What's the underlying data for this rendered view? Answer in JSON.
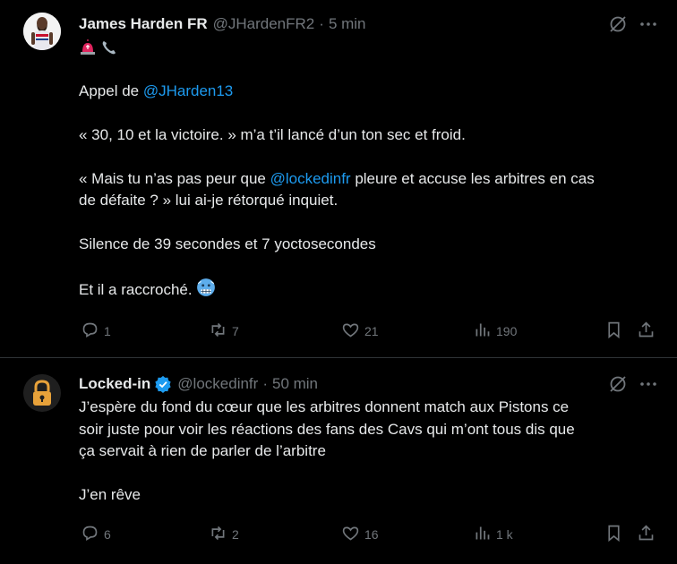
{
  "tweets": [
    {
      "name": "James Harden FR",
      "handle": "@JHardenFR2",
      "separator": "·",
      "time": "5 min",
      "lines": {
        "l1_prefix": "Appel de ",
        "l1_mention": "@JHarden13",
        "l2": "« 30, 10 et la victoire. » m’a t’il lancé d’un ton sec et froid.",
        "l3_prefix": "« Mais tu n’as pas peur que ",
        "l3_mention": "@lockedinfr",
        "l3_suffix": " pleure et accuse les arbitres en cas",
        "l3_cont": "de défaite ? » lui ai-je rétorqué inquiet.",
        "l4": "Silence de 39 secondes et 7 yoctosecondes",
        "l5": "Et il a raccroché. "
      },
      "emojis": [
        "siren-emoji",
        "telephone-emoji",
        "cold-face-emoji"
      ],
      "stats": {
        "replies": "1",
        "reposts": "7",
        "likes": "21",
        "views": "190"
      }
    },
    {
      "name": "Locked-in",
      "handle": "@lockedinfr",
      "separator": "·",
      "time": "50 min",
      "verified": true,
      "lines": {
        "l1": "J’espère du fond du cœur que les arbitres donnent match aux Pistons ce",
        "l2": "soir juste pour voir les réactions des fans des Cavs qui m’ont tous dis que",
        "l3": "ça servait à rien de parler de l’arbitre",
        "l4": "J’en rêve"
      },
      "stats": {
        "replies": "6",
        "reposts": "2",
        "likes": "16",
        "views": "1 k"
      }
    }
  ],
  "colors": {
    "background": "#000000",
    "text": "#e7e9ea",
    "muted": "#71767b",
    "link": "#1d9bf0",
    "verified": "#1d9bf0",
    "divider": "#2f3336"
  },
  "icons": [
    "grok-icon",
    "more-icon",
    "reply-icon",
    "repost-icon",
    "like-icon",
    "views-icon",
    "bookmark-icon",
    "share-icon",
    "verified-badge-icon"
  ]
}
